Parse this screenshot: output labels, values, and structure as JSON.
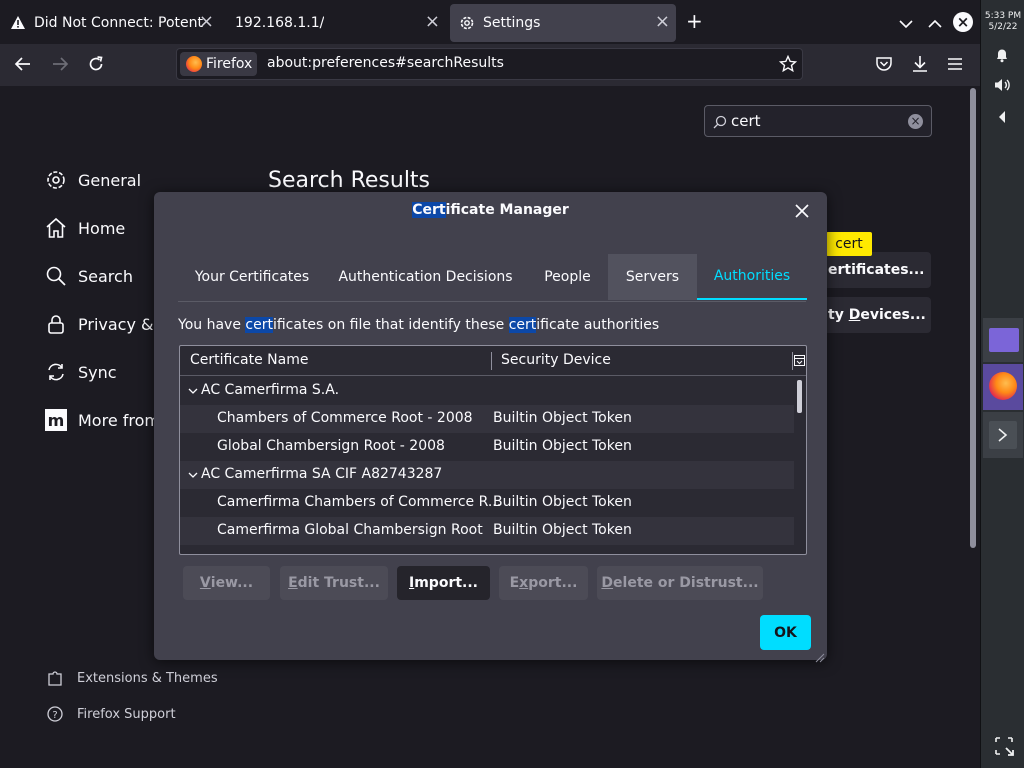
{
  "tabs": [
    {
      "label": "Did Not Connect: Potential",
      "icon": "warning-icon"
    },
    {
      "label": "192.168.1.1/",
      "icon": ""
    },
    {
      "label": "Settings",
      "icon": "gear-icon"
    }
  ],
  "navbar": {
    "identity_label": "Firefox",
    "url": "about:preferences#searchResults"
  },
  "system": {
    "time": "5:33 PM",
    "date": "5/2/22"
  },
  "search": {
    "value": "cert"
  },
  "sidebar": {
    "items": [
      {
        "label": "General",
        "icon": "gear-icon"
      },
      {
        "label": "Home",
        "icon": "home-icon"
      },
      {
        "label": "Search",
        "icon": "search-icon"
      },
      {
        "label": "Privacy & S",
        "icon": "lock-icon"
      },
      {
        "label": "Sync",
        "icon": "sync-icon"
      },
      {
        "label": "More from",
        "icon": "mozilla-icon"
      }
    ],
    "footer": [
      {
        "label": "Extensions & Themes",
        "icon": "puzzle-icon"
      },
      {
        "label": "Firefox Support",
        "icon": "help-icon"
      }
    ]
  },
  "main": {
    "title": "Search Results",
    "highlight_tooltip": "cert",
    "bg_button_1": "ertificates...",
    "bg_button_2_pre": "ty ",
    "bg_button_2_ul": "D",
    "bg_button_2_post": "evices..."
  },
  "dialog": {
    "title_hl": "Cert",
    "title_rest": "ificate Manager",
    "tabs": [
      "Your Certificates",
      "Authentication Decisions",
      "People",
      "Servers",
      "Authorities"
    ],
    "selected_tab": "Authorities",
    "desc": {
      "p1": "You have ",
      "h1": "cert",
      "p2": "ificates on file that identify these ",
      "h2": "cert",
      "p3": "ificate authorities"
    },
    "columns": [
      "Certificate Name",
      "Security Device"
    ],
    "rows": [
      {
        "type": "group",
        "name": "AC Camerfirma S.A.",
        "device": ""
      },
      {
        "type": "child",
        "name": "Chambers of Commerce Root - 2008",
        "device": "Builtin Object Token"
      },
      {
        "type": "child",
        "name": "Global Chambersign Root - 2008",
        "device": "Builtin Object Token"
      },
      {
        "type": "group",
        "name": "AC Camerfirma SA CIF A82743287",
        "device": ""
      },
      {
        "type": "child",
        "name": "Camerfirma Chambers of Commerce R...",
        "device": "Builtin Object Token"
      },
      {
        "type": "child",
        "name": "Camerfirma Global Chambersign Root",
        "device": "Builtin Object Token"
      }
    ],
    "buttons": [
      {
        "pre": "",
        "ul": "V",
        "post": "iew...",
        "enabled": false
      },
      {
        "pre": "",
        "ul": "E",
        "post": "dit Trust...",
        "enabled": false
      },
      {
        "pre": "",
        "ul": "I",
        "post": "mport...",
        "enabled": true
      },
      {
        "pre": "E",
        "ul": "x",
        "post": "port...",
        "enabled": false
      },
      {
        "pre": "",
        "ul": "D",
        "post": "elete or Distrust...",
        "enabled": false
      }
    ],
    "ok_label": "OK"
  },
  "colors": {
    "accent": "#00ddff",
    "highlight": "#0c48a8",
    "find_yellow": "#ffe900"
  }
}
